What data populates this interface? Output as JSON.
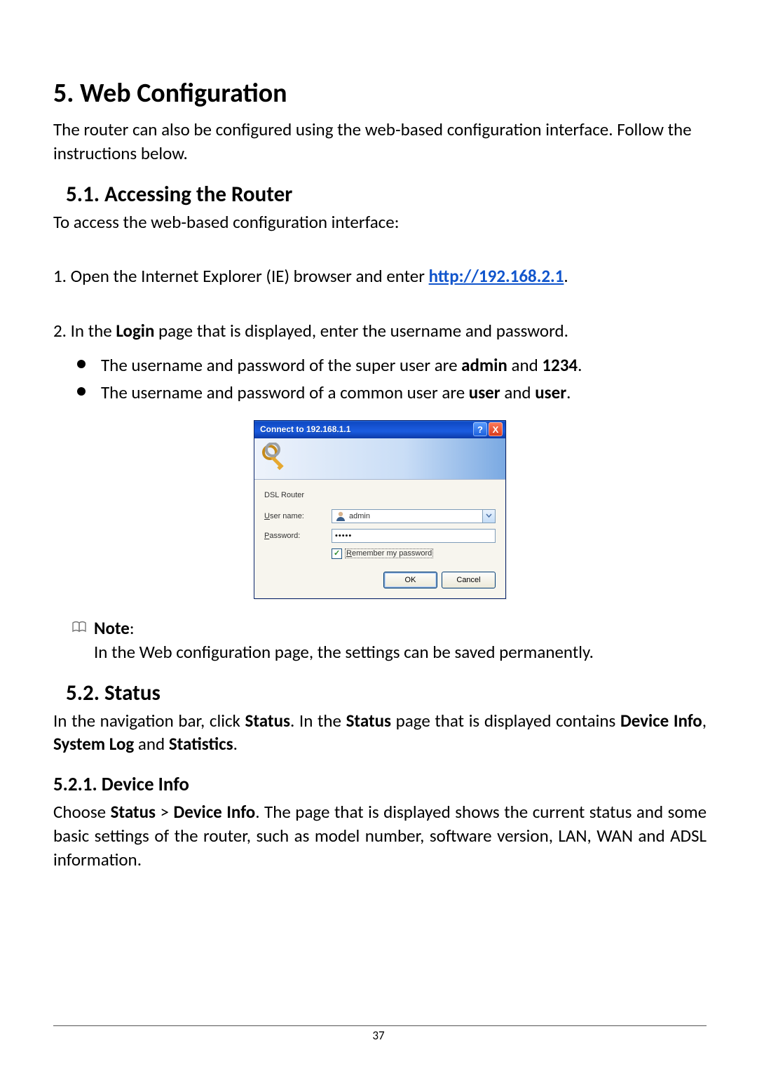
{
  "headings": {
    "h1": "5. Web Configuration",
    "h2a": "5.1.  Accessing the Router",
    "h2b": "5.2.  Status",
    "h3a": "5.2.1.   Device Info"
  },
  "intro": "The router can also be configured using the web-based configuration interface. Follow the instructions below.",
  "access_intro": "To access the web-based configuration interface:",
  "steps": {
    "s1_prefix": "1. Open the Internet Explorer (IE) browser and enter ",
    "s1_link": "http://192.168.2.1",
    "s1_suffix": ".",
    "s2_a": "2. In the ",
    "s2_b": "Login",
    "s2_c": " page that is displayed, enter the username and password."
  },
  "bullets": {
    "b1_a": "The username and password of the super user are ",
    "b1_b": "admin",
    "b1_c": " and ",
    "b1_d": "1234",
    "b1_e": ".",
    "b2_a": "The username and password of a common user are ",
    "b2_b": "user",
    "b2_c": " and ",
    "b2_d": "user",
    "b2_e": "."
  },
  "dialog": {
    "title": "Connect to 192.168.1.1",
    "help": "?",
    "close": "X",
    "realm": "DSL Router",
    "user_label_u": "U",
    "user_label_rest": "ser name:",
    "user_value": "admin",
    "pass_label_u": "P",
    "pass_label_rest": "assword:",
    "pass_dots": "•••••",
    "remember_u": "R",
    "remember_rest": "emember my password",
    "ok": "OK",
    "cancel": "Cancel"
  },
  "note": {
    "label": "Note",
    "colon": ":",
    "text": "In the Web configuration page, the settings can be saved permanently."
  },
  "status": {
    "p_a": "In the navigation bar, click ",
    "p_b": "Status",
    "p_c": ". In the ",
    "p_d": "Status",
    "p_e": " page that is displayed contains ",
    "p_f": "Device Info",
    "p_g": ", ",
    "p_h": "System Log",
    "p_i": " and ",
    "p_j": "Statistics",
    "p_k": "."
  },
  "devinfo": {
    "a": "Choose ",
    "b": "Status",
    "c": " > ",
    "d": "Device Info",
    "e": ". The page that is displayed shows the current status and some basic settings of the router, such as model number, software version, LAN, WAN and ADSL information."
  },
  "page_number": "37"
}
